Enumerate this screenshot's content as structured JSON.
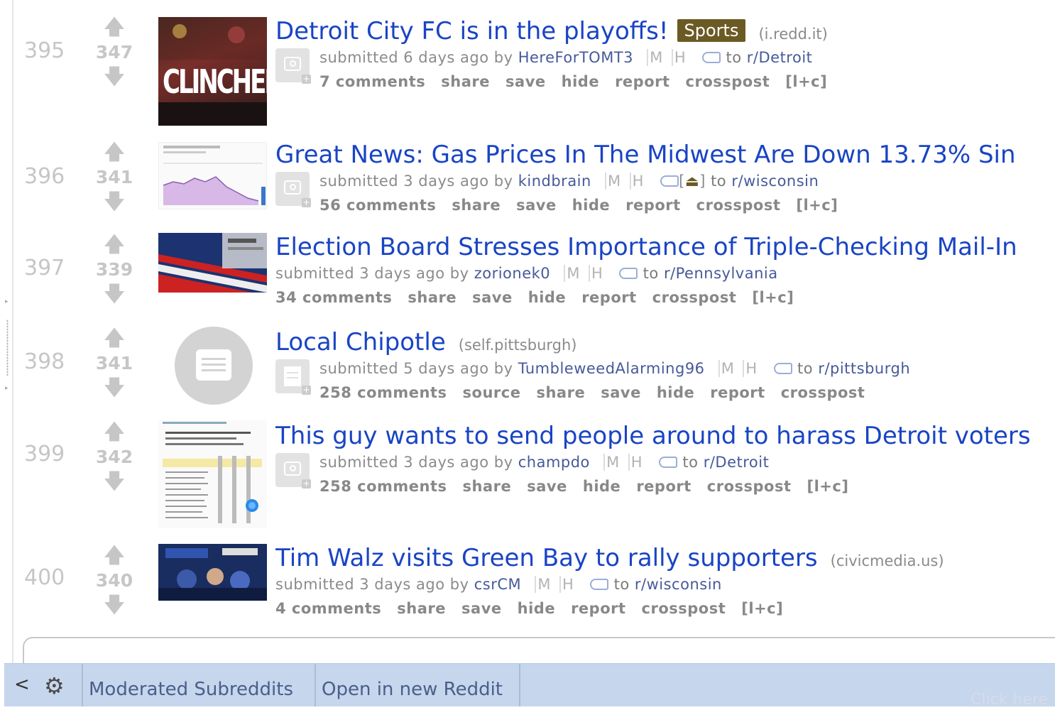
{
  "posts": [
    {
      "rank": "395",
      "score": "347",
      "title": "Detroit City FC is in the playoffs!",
      "flair": "Sports",
      "domain": "(i.redd.it)",
      "submitted": "submitted 6 days ago by",
      "author": "HereForTOMT3",
      "mod_m": "M",
      "mod_h": "H",
      "to": "to",
      "subreddit": "r/Detroit",
      "buttons": [
        "7 comments",
        "share",
        "save",
        "hide",
        "report",
        "crosspost",
        "[l+c]"
      ],
      "thumb_text": "CLINCHED"
    },
    {
      "rank": "396",
      "score": "341",
      "title": "Great News: Gas Prices In The Midwest Are Down 13.73% Sin",
      "submitted": "submitted 3 days ago by",
      "author": "kindbrain",
      "mod_m": "M",
      "mod_h": "H",
      "extra": "[",
      "extra_end": "]",
      "to": "to",
      "subreddit": "r/wisconsin",
      "buttons": [
        "56 comments",
        "share",
        "save",
        "hide",
        "report",
        "crosspost",
        "[l+c]"
      ]
    },
    {
      "rank": "397",
      "score": "339",
      "title": "Election Board Stresses Importance of Triple-Checking Mail-In",
      "submitted": "submitted 3 days ago by",
      "author": "zorionek0",
      "mod_m": "M",
      "mod_h": "H",
      "to": "to",
      "subreddit": "r/Pennsylvania",
      "buttons": [
        "34 comments",
        "share",
        "save",
        "hide",
        "report",
        "crosspost",
        "[l+c]"
      ]
    },
    {
      "rank": "398",
      "score": "341",
      "title": "Local Chipotle",
      "domain": "(self.pittsburgh)",
      "submitted": "submitted 5 days ago by",
      "author": "TumbleweedAlarming96",
      "mod_m": "M",
      "mod_h": "H",
      "to": "to",
      "subreddit": "r/pittsburgh",
      "buttons": [
        "258 comments",
        "source",
        "share",
        "save",
        "hide",
        "report",
        "crosspost"
      ]
    },
    {
      "rank": "399",
      "score": "342",
      "title": "This guy wants to send people around to harass Detroit voters",
      "submitted": "submitted 3 days ago by",
      "author": "champdo",
      "mod_m": "M",
      "mod_h": "H",
      "to": "to",
      "subreddit": "r/Detroit",
      "buttons": [
        "258 comments",
        "share",
        "save",
        "hide",
        "report",
        "crosspost",
        "[l+c]"
      ]
    },
    {
      "rank": "400",
      "score": "340",
      "title": "Tim Walz visits Green Bay to rally supporters",
      "domain": "(civicmedia.us)",
      "submitted": "submitted 3 days ago by",
      "author": "csrCM",
      "mod_m": "M",
      "mod_h": "H",
      "to": "to",
      "subreddit": "r/wisconsin",
      "buttons": [
        "4 comments",
        "share",
        "save",
        "hide",
        "report",
        "crosspost",
        "[l+c]"
      ]
    }
  ],
  "toolbar": {
    "moderated": "Moderated Subreddits",
    "open_new": "Open in new Reddit",
    "hint": "Click here"
  },
  "icons": {
    "upvote": "arrow-up-icon",
    "downvote": "arrow-down-icon",
    "back": "chevron-left-icon",
    "settings": "gear-icon"
  },
  "colors": {
    "link": "#1944c4",
    "flair_bg": "#6b5a24",
    "toolbar_bg": "#c6d6ec"
  }
}
